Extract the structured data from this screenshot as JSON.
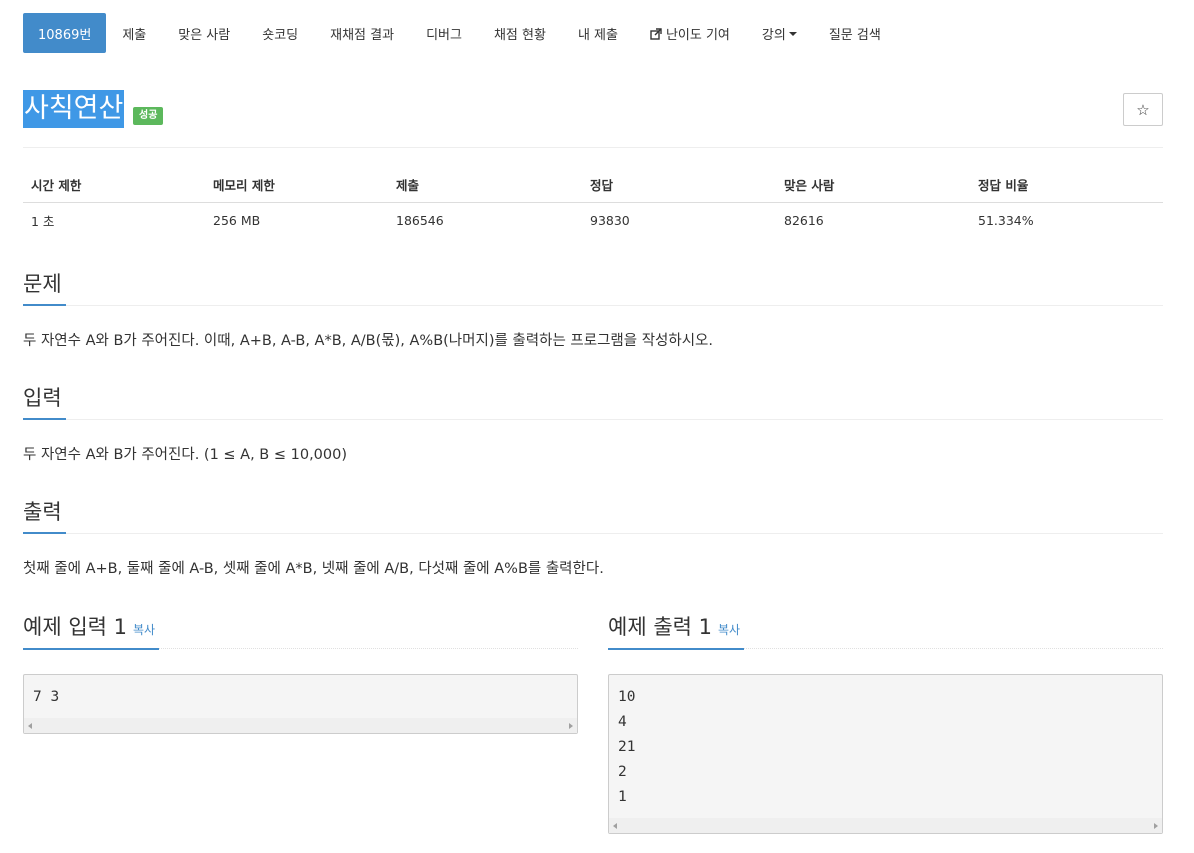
{
  "nav": {
    "items": [
      {
        "label": "10869번",
        "active": true
      },
      {
        "label": "제출"
      },
      {
        "label": "맞은 사람"
      },
      {
        "label": "숏코딩"
      },
      {
        "label": "재채점 결과"
      },
      {
        "label": "디버그"
      },
      {
        "label": "채점 현황"
      },
      {
        "label": "내 제출"
      },
      {
        "label": "난이도 기여",
        "icon": "external-link-icon"
      },
      {
        "label": "강의",
        "icon": "caret-down-icon"
      },
      {
        "label": "질문 검색"
      }
    ]
  },
  "problem": {
    "title": "사칙연산",
    "status_badge": "성공",
    "star_icon": "☆"
  },
  "info_table": {
    "headers": [
      "시간 제한",
      "메모리 제한",
      "제출",
      "정답",
      "맞은 사람",
      "정답 비율"
    ],
    "values": [
      "1 초",
      "256 MB",
      "186546",
      "93830",
      "82616",
      "51.334%"
    ]
  },
  "sections": {
    "problem_heading": "문제",
    "problem_text": "두 자연수 A와 B가 주어진다. 이때, A+B, A-B, A*B, A/B(몫), A%B(나머지)를 출력하는 프로그램을 작성하시오.",
    "input_heading": "입력",
    "input_text": "두 자연수 A와 B가 주어진다. (1 ≤ A, B ≤ 10,000)",
    "output_heading": "출력",
    "output_text": "첫째 줄에 A+B, 둘째 줄에 A-B, 셋째 줄에 A*B, 넷째 줄에 A/B, 다섯째 줄에 A%B를 출력한다."
  },
  "samples": {
    "input_heading": "예제 입력 1",
    "output_heading": "예제 출력 1",
    "copy_label": "복사",
    "input_code": "7 3",
    "output_code": "10\n4\n21\n2\n1"
  },
  "colors": {
    "accent": "#428bca",
    "title_highlight": "#3f98e6",
    "success": "#5cb85c"
  }
}
